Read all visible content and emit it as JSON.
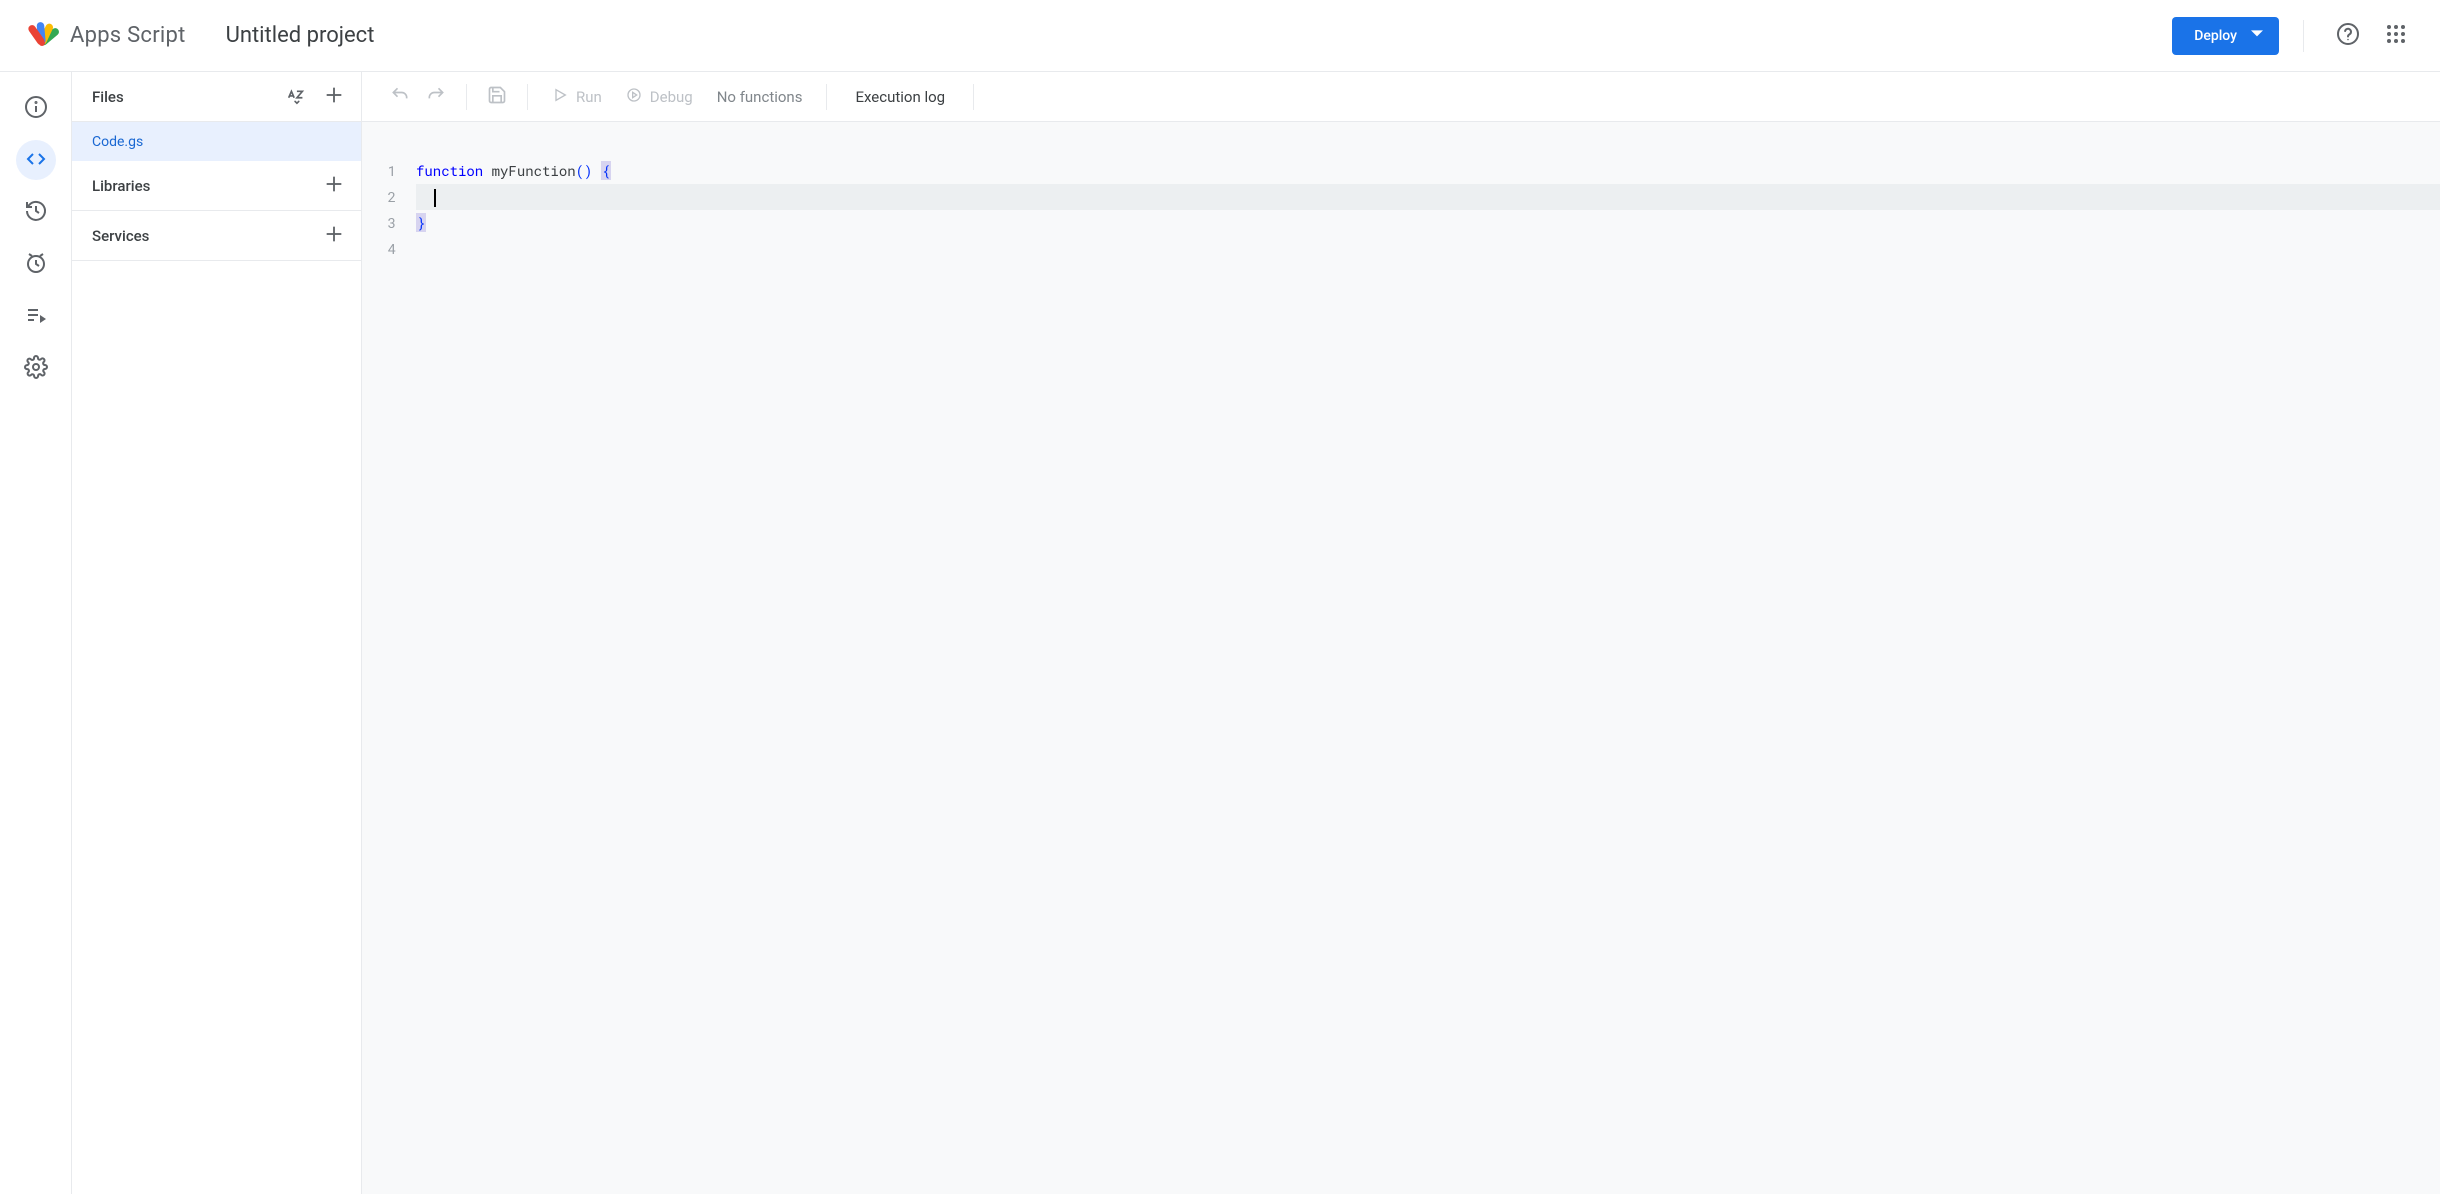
{
  "header": {
    "product_name": "Apps Script",
    "project_title": "Untitled project",
    "deploy_label": "Deploy"
  },
  "rail": {
    "items": [
      {
        "name": "overview",
        "icon": "info"
      },
      {
        "name": "editor",
        "icon": "code",
        "active": true
      },
      {
        "name": "history",
        "icon": "history"
      },
      {
        "name": "triggers",
        "icon": "clock"
      },
      {
        "name": "executions",
        "icon": "executions"
      },
      {
        "name": "settings",
        "icon": "gear"
      }
    ]
  },
  "sidebar": {
    "files_label": "Files",
    "files": [
      {
        "name": "Code.gs",
        "selected": true
      }
    ],
    "libraries_label": "Libraries",
    "services_label": "Services"
  },
  "toolbar": {
    "run_label": "Run",
    "debug_label": "Debug",
    "no_functions_label": "No functions",
    "execution_log_label": "Execution log"
  },
  "editor": {
    "lines": [
      {
        "n": 1,
        "tokens": [
          {
            "t": "function",
            "c": "kw"
          },
          {
            "t": " ",
            "c": ""
          },
          {
            "t": "myFunction",
            "c": "fn"
          },
          {
            "t": "(",
            "c": "paren"
          },
          {
            "t": ")",
            "c": "paren"
          },
          {
            "t": " ",
            "c": ""
          },
          {
            "t": "{",
            "c": "brace-hl"
          }
        ]
      },
      {
        "n": 2,
        "current": true,
        "indent": "  ",
        "cursor": true
      },
      {
        "n": 3,
        "tokens": [
          {
            "t": "}",
            "c": "brace-hl"
          }
        ]
      },
      {
        "n": 4
      }
    ]
  }
}
